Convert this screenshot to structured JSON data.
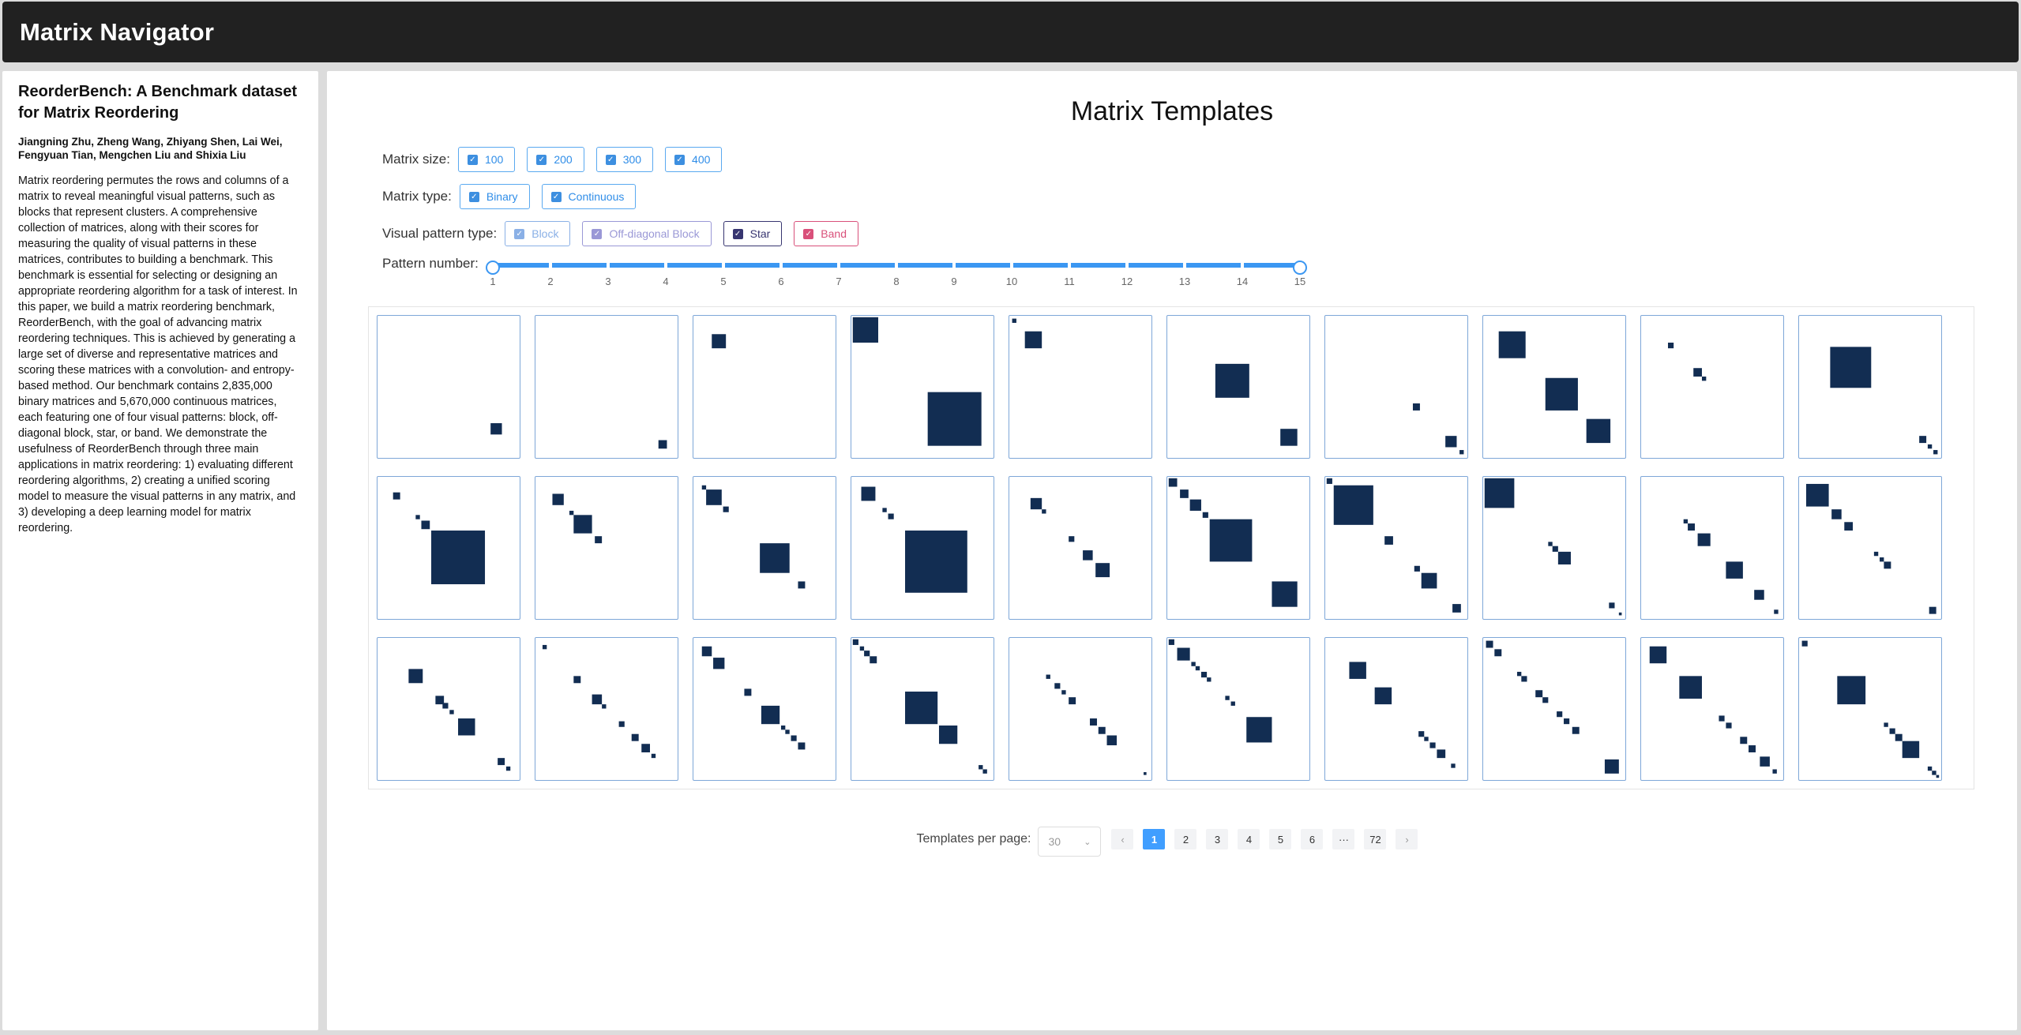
{
  "app": {
    "title": "Matrix Navigator"
  },
  "paper": {
    "title": "ReorderBench: A Benchmark dataset for Matrix Reordering",
    "authors": "Jiangning Zhu, Zheng Wang, Zhiyang Shen, Lai Wei, Fengyuan Tian, Mengchen Liu and Shixia Liu",
    "abstract": "Matrix reordering permutes the rows and columns of a matrix to reveal meaningful visual patterns, such as blocks that represent clusters. A comprehensive collection of matrices, along with their scores for measuring the quality of visual patterns in these matrices, contributes to building a benchmark. This benchmark is essential for selecting or designing an appropriate reordering algorithm for a task of interest. In this paper, we build a matrix reordering benchmark, ReorderBench, with the goal of advancing matrix reordering techniques. This is achieved by generating a large set of diverse and representative matrices and scoring these matrices with a convolution- and entropy-based method. Our benchmark contains 2,835,000 binary matrices and 5,670,000 continuous matrices, each featuring one of four visual patterns: block, off-diagonal block, star, or band. We demonstrate the usefulness of ReorderBench through three main applications in matrix reordering: 1) evaluating different reordering algorithms, 2) creating a unified scoring model to measure the visual patterns in any matrix, and 3) developing a deep learning model for matrix reordering."
  },
  "main": {
    "title": "Matrix Templates"
  },
  "filters": {
    "size": {
      "label": "Matrix size:",
      "options": [
        "100",
        "200",
        "300",
        "400"
      ]
    },
    "type": {
      "label": "Matrix type:",
      "options": [
        "Binary",
        "Continuous"
      ]
    },
    "pattern": {
      "label": "Visual pattern type:",
      "options": [
        {
          "label": "Block",
          "color": "#8ab0e6"
        },
        {
          "label": "Off-diagonal Block",
          "color": "#9a98d6"
        },
        {
          "label": "Star",
          "color": "#373570"
        },
        {
          "label": "Band",
          "color": "#d9507a"
        }
      ]
    }
  },
  "slider": {
    "label": "Pattern number:",
    "ticks": [
      "1",
      "2",
      "3",
      "4",
      "5",
      "6",
      "7",
      "8",
      "9",
      "10",
      "11",
      "12",
      "13",
      "14",
      "15"
    ],
    "min": 1,
    "max": 15
  },
  "templates": [
    [
      [
        80,
        76,
        8,
        8
      ]
    ],
    [
      [
        87,
        88,
        6,
        6
      ]
    ],
    [
      [
        13,
        13,
        10,
        10
      ]
    ],
    [
      [
        1,
        1,
        18,
        18
      ],
      [
        54,
        54,
        38,
        38
      ]
    ],
    [
      [
        2,
        2,
        3,
        3
      ],
      [
        11,
        11,
        12,
        12
      ]
    ],
    [
      [
        34,
        34,
        24,
        24
      ],
      [
        80,
        80,
        12,
        12
      ]
    ],
    [
      [
        62,
        62,
        5,
        5
      ],
      [
        85,
        85,
        8,
        8
      ],
      [
        95,
        95,
        3,
        3
      ]
    ],
    [
      [
        11,
        11,
        19,
        19
      ],
      [
        44,
        44,
        23,
        23
      ],
      [
        73,
        73,
        17,
        17
      ]
    ],
    [
      [
        19,
        19,
        4,
        4
      ],
      [
        37,
        37,
        6,
        6
      ],
      [
        43,
        43,
        3,
        3
      ]
    ],
    [
      [
        22,
        22,
        29,
        29
      ],
      [
        85,
        85,
        5,
        5
      ],
      [
        91,
        91,
        3,
        3
      ],
      [
        95,
        95,
        3,
        3
      ]
    ],
    [
      [
        11,
        11,
        5,
        5
      ],
      [
        27,
        27,
        3,
        3
      ],
      [
        31,
        31,
        6,
        6
      ],
      [
        38,
        38,
        38,
        38
      ]
    ],
    [
      [
        12,
        12,
        8,
        8
      ],
      [
        24,
        24,
        3,
        3
      ],
      [
        27,
        27,
        13,
        13
      ],
      [
        42,
        42,
        5,
        5
      ]
    ],
    [
      [
        6,
        6,
        3,
        3
      ],
      [
        9,
        9,
        11,
        11
      ],
      [
        21,
        21,
        4,
        4
      ],
      [
        47,
        47,
        21,
        21
      ],
      [
        74,
        74,
        5,
        5
      ]
    ],
    [
      [
        7,
        7,
        10,
        10
      ],
      [
        22,
        22,
        3,
        3
      ],
      [
        26,
        26,
        4,
        4
      ],
      [
        38,
        38,
        44,
        44
      ]
    ],
    [
      [
        15,
        15,
        8,
        8
      ],
      [
        23,
        23,
        3,
        3
      ],
      [
        42,
        42,
        4,
        4
      ],
      [
        52,
        52,
        7,
        7
      ],
      [
        61,
        61,
        10,
        10
      ]
    ],
    [
      [
        1,
        1,
        6,
        6
      ],
      [
        9,
        9,
        6,
        6
      ],
      [
        16,
        16,
        8,
        8
      ],
      [
        25,
        25,
        4,
        4
      ],
      [
        30,
        30,
        30,
        30
      ],
      [
        74,
        74,
        18,
        18
      ]
    ],
    [
      [
        1,
        1,
        4,
        4
      ],
      [
        6,
        6,
        28,
        28
      ],
      [
        42,
        42,
        6,
        6
      ],
      [
        63,
        63,
        4,
        4
      ],
      [
        68,
        68,
        11,
        11
      ],
      [
        90,
        90,
        6,
        6
      ]
    ],
    [
      [
        1,
        1,
        21,
        21
      ],
      [
        46,
        46,
        3,
        3
      ],
      [
        49,
        49,
        4,
        4
      ],
      [
        53,
        53,
        9,
        9
      ],
      [
        89,
        89,
        4,
        4
      ],
      [
        96,
        96,
        2,
        2
      ]
    ],
    [
      [
        30,
        30,
        3,
        3
      ],
      [
        33,
        33,
        5,
        5
      ],
      [
        40,
        40,
        9,
        9
      ],
      [
        60,
        60,
        12,
        12
      ],
      [
        80,
        80,
        7,
        7
      ],
      [
        94,
        94,
        3,
        3
      ]
    ],
    [
      [
        5,
        5,
        16,
        16
      ],
      [
        23,
        23,
        7,
        7
      ],
      [
        32,
        32,
        6,
        6
      ],
      [
        53,
        53,
        3,
        3
      ],
      [
        57,
        57,
        3,
        3
      ],
      [
        60,
        60,
        5,
        5
      ],
      [
        92,
        92,
        5,
        5
      ]
    ],
    [
      [
        22,
        22,
        10,
        10
      ],
      [
        41,
        41,
        6,
        6
      ],
      [
        46,
        46,
        4,
        4
      ],
      [
        51,
        51,
        3,
        3
      ],
      [
        57,
        57,
        12,
        12
      ],
      [
        85,
        85,
        5,
        5
      ],
      [
        91,
        91,
        3,
        3
      ]
    ],
    [
      [
        5,
        5,
        3,
        3
      ],
      [
        27,
        27,
        5,
        5
      ],
      [
        40,
        40,
        7,
        7
      ],
      [
        47,
        47,
        3,
        3
      ],
      [
        59,
        59,
        4,
        4
      ],
      [
        68,
        68,
        5,
        5
      ],
      [
        75,
        75,
        6,
        6
      ],
      [
        82,
        82,
        3,
        3
      ]
    ],
    [
      [
        6,
        6,
        7,
        7
      ],
      [
        14,
        14,
        8,
        8
      ],
      [
        36,
        36,
        5,
        5
      ],
      [
        48,
        48,
        13,
        13
      ],
      [
        62,
        62,
        3,
        3
      ],
      [
        65,
        65,
        3,
        3
      ],
      [
        69,
        69,
        4,
        4
      ],
      [
        74,
        74,
        5,
        5
      ]
    ],
    [
      [
        1,
        1,
        4,
        4
      ],
      [
        6,
        6,
        3,
        3
      ],
      [
        9,
        9,
        4,
        4
      ],
      [
        13,
        13,
        5,
        5
      ],
      [
        38,
        38,
        23,
        23
      ],
      [
        62,
        62,
        13,
        13
      ],
      [
        90,
        90,
        3,
        3
      ],
      [
        93,
        93,
        3,
        3
      ]
    ],
    [
      [
        26,
        26,
        3,
        3
      ],
      [
        32,
        32,
        4,
        4
      ],
      [
        37,
        37,
        3,
        3
      ],
      [
        42,
        42,
        5,
        5
      ],
      [
        57,
        57,
        5,
        5
      ],
      [
        63,
        63,
        5,
        5
      ],
      [
        69,
        69,
        7,
        7
      ],
      [
        95,
        95,
        2,
        2
      ]
    ],
    [
      [
        1,
        1,
        4,
        4
      ],
      [
        7,
        7,
        9,
        9
      ],
      [
        17,
        17,
        3,
        3
      ],
      [
        20,
        20,
        3,
        3
      ],
      [
        24,
        24,
        4,
        4
      ],
      [
        28,
        28,
        3,
        3
      ],
      [
        41,
        41,
        3,
        3
      ],
      [
        45,
        45,
        3,
        3
      ],
      [
        56,
        56,
        18,
        18
      ]
    ],
    [
      [
        17,
        17,
        12,
        12
      ],
      [
        35,
        35,
        12,
        12
      ],
      [
        66,
        66,
        4,
        4
      ],
      [
        70,
        70,
        3,
        3
      ],
      [
        74,
        74,
        4,
        4
      ],
      [
        79,
        79,
        6,
        6
      ],
      [
        89,
        89,
        3,
        3
      ]
    ],
    [
      [
        2,
        2,
        5,
        5
      ],
      [
        8,
        8,
        5,
        5
      ],
      [
        24,
        24,
        3,
        3
      ],
      [
        27,
        27,
        4,
        4
      ],
      [
        37,
        37,
        5,
        5
      ],
      [
        42,
        42,
        4,
        4
      ],
      [
        52,
        52,
        4,
        4
      ],
      [
        57,
        57,
        4,
        4
      ],
      [
        63,
        63,
        5,
        5
      ],
      [
        86,
        86,
        10,
        10
      ]
    ],
    [
      [
        6,
        6,
        12,
        12
      ],
      [
        27,
        27,
        16,
        16
      ],
      [
        55,
        55,
        4,
        4
      ],
      [
        60,
        60,
        4,
        4
      ],
      [
        70,
        70,
        5,
        5
      ],
      [
        76,
        76,
        5,
        5
      ],
      [
        84,
        84,
        7,
        7
      ],
      [
        93,
        93,
        3,
        3
      ]
    ],
    [
      [
        2,
        2,
        4,
        4
      ],
      [
        27,
        27,
        20,
        20
      ],
      [
        60,
        60,
        3,
        3
      ],
      [
        64,
        64,
        4,
        4
      ],
      [
        68,
        68,
        5,
        5
      ],
      [
        73,
        73,
        12,
        12
      ],
      [
        91,
        91,
        3,
        3
      ],
      [
        94,
        94,
        3,
        3
      ],
      [
        97,
        97,
        2,
        2
      ]
    ]
  ],
  "pagination": {
    "label": "Templates per page:",
    "per_page": "30",
    "prev": "‹",
    "next": "›",
    "pages": [
      "1",
      "2",
      "3",
      "4",
      "5",
      "6",
      "···",
      "72"
    ],
    "active": "1"
  }
}
